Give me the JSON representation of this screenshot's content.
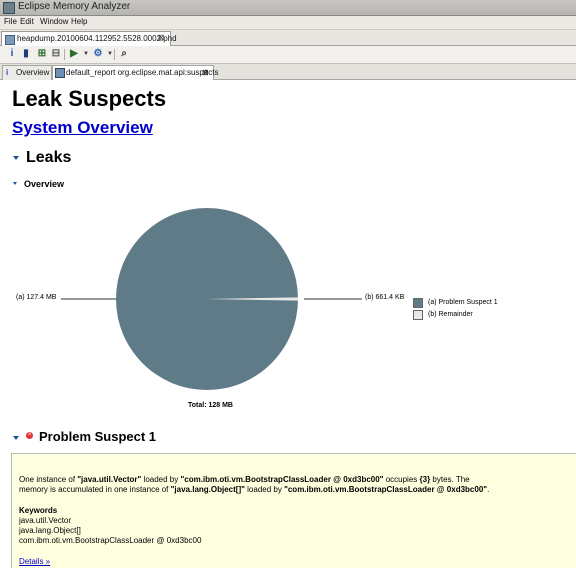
{
  "window": {
    "title": "Eclipse Memory Analyzer"
  },
  "menu": [
    "File",
    "Edit",
    "Window",
    "Help"
  ],
  "editor_tab": {
    "label": "heapdump.20100604.112952.5528.0002.phd",
    "close": "⊠"
  },
  "view_tabs": [
    {
      "label": "Overview"
    },
    {
      "label": "default_report  org.eclipse.mat.api:suspects",
      "close": "⊠"
    }
  ],
  "report": {
    "title": "Leak Suspects",
    "system_overview_link": "System Overview",
    "leaks_heading": "Leaks",
    "overview_heading": "Overview",
    "pie": {
      "label_a": "(a)  127.4 MB",
      "label_b": "(b)  661.4 KB",
      "total": "Total: 128 MB",
      "legend": [
        {
          "label": "(a)  Problem Suspect 1",
          "color": "#607b88"
        },
        {
          "label": "(b)  Remainder",
          "color": "#e8e8e8"
        }
      ]
    },
    "suspect_heading": "Problem Suspect 1",
    "suspect": {
      "line1_a": "One instance of ",
      "line1_b": "\"java.util.Vector\"",
      "line1_c": " loaded by ",
      "line1_d": "\"com.ibm.oti.vm.BootstrapClassLoader @ 0xd3bc00\"",
      "line1_e": " occupies ",
      "line1_f": "{3}",
      "line1_g": " bytes. The",
      "line2_a": "memory is accumulated in one instance of ",
      "line2_b": "\"java.lang.Object[]\"",
      "line2_c": " loaded by ",
      "line2_d": "\"com.ibm.oti.vm.BootstrapClassLoader @ 0xd3bc00\"",
      "line2_e": ".",
      "keywords_heading": "Keywords",
      "keywords": [
        "java.util.Vector",
        "java.lang.Object[]",
        "com.ibm.oti.vm.BootstrapClassLoader @ 0xd3bc00"
      ],
      "details_link": "Details »"
    }
  },
  "chart_data": {
    "type": "pie",
    "categories": [
      "(a) Problem Suspect 1",
      "(b) Remainder"
    ],
    "values": [
      127.4,
      0.646
    ],
    "units": [
      "127.4 MB",
      "661.4 KB"
    ],
    "total": "Total: 128 MB",
    "colors": [
      "#607b88",
      "#e8e8e8"
    ],
    "legend": "right"
  }
}
